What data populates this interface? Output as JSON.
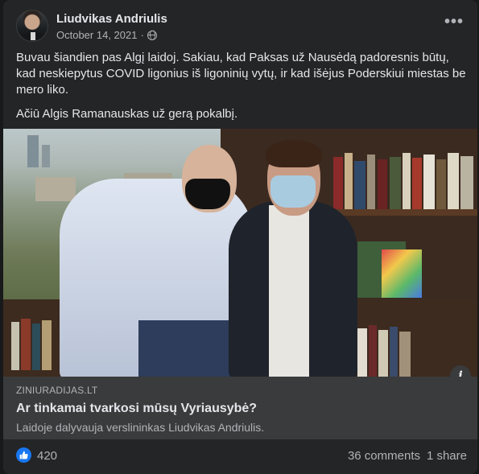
{
  "post": {
    "author": "Liudvikas Andriulis",
    "date": "October 14, 2021",
    "separator": "·",
    "privacy_icon": "globe-icon",
    "more_icon": "•••",
    "text_paragraphs": [
      "Buvau šiandien pas Algį laidoj. Sakiau, kad Paksas už Nausėdą padoresnis būtų, kad neskiepytus COVID ligonius iš ligoninių vytų, ir kad išėjus Poderskiui miestas be mero liko.",
      "Ačiū Algis Ramanauskas už gerą pokalbį."
    ]
  },
  "link_preview": {
    "domain": "ZINIURADIJAS.LT",
    "title": "Ar tinkamai tvarkosi mūsų Vyriausybė?",
    "description": "Laidoje dalyvauja verslininkas Liudvikas Andriulis.",
    "info_icon": "i"
  },
  "engagement": {
    "reaction_count": "420",
    "comments": "36 comments",
    "shares": "1 share"
  },
  "colors": {
    "background": "#18191a",
    "card": "#242526",
    "link_box": "#3a3b3c",
    "like_blue": "#1877f2"
  }
}
